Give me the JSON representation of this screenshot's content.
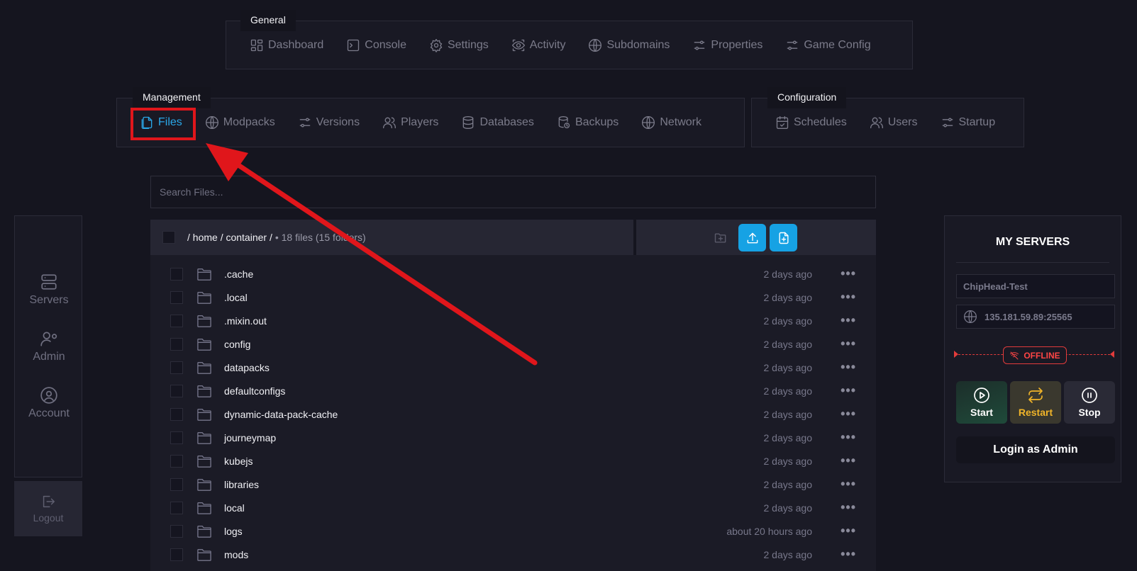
{
  "groups": {
    "general": {
      "title": "General",
      "items": [
        {
          "label": "Dashboard",
          "icon": "dashboard-icon"
        },
        {
          "label": "Console",
          "icon": "console-icon"
        },
        {
          "label": "Settings",
          "icon": "gear-icon"
        },
        {
          "label": "Activity",
          "icon": "eye-icon"
        },
        {
          "label": "Subdomains",
          "icon": "globe-icon"
        },
        {
          "label": "Properties",
          "icon": "sliders-icon"
        },
        {
          "label": "Game Config",
          "icon": "sliders-icon"
        }
      ]
    },
    "management": {
      "title": "Management",
      "items": [
        {
          "label": "Files",
          "icon": "files-icon",
          "active": true
        },
        {
          "label": "Modpacks",
          "icon": "globe-icon"
        },
        {
          "label": "Versions",
          "icon": "sliders-icon"
        },
        {
          "label": "Players",
          "icon": "users-icon"
        },
        {
          "label": "Databases",
          "icon": "database-icon"
        },
        {
          "label": "Backups",
          "icon": "backup-icon"
        },
        {
          "label": "Network",
          "icon": "globe-icon"
        }
      ]
    },
    "configuration": {
      "title": "Configuration",
      "items": [
        {
          "label": "Schedules",
          "icon": "calendar-icon"
        },
        {
          "label": "Users",
          "icon": "users-icon"
        },
        {
          "label": "Startup",
          "icon": "sliders-icon"
        }
      ]
    }
  },
  "search": {
    "placeholder": "Search Files..."
  },
  "path": {
    "text": "/ home / container /",
    "count": "• 18 files (15 folders)"
  },
  "files": [
    {
      "name": ".cache",
      "date": "2 days ago"
    },
    {
      "name": ".local",
      "date": "2 days ago"
    },
    {
      "name": ".mixin.out",
      "date": "2 days ago"
    },
    {
      "name": "config",
      "date": "2 days ago"
    },
    {
      "name": "datapacks",
      "date": "2 days ago"
    },
    {
      "name": "defaultconfigs",
      "date": "2 days ago"
    },
    {
      "name": "dynamic-data-pack-cache",
      "date": "2 days ago"
    },
    {
      "name": "journeymap",
      "date": "2 days ago"
    },
    {
      "name": "kubejs",
      "date": "2 days ago"
    },
    {
      "name": "libraries",
      "date": "2 days ago"
    },
    {
      "name": "local",
      "date": "2 days ago"
    },
    {
      "name": "logs",
      "date": "about 20 hours ago"
    },
    {
      "name": "mods",
      "date": "2 days ago"
    }
  ],
  "sidebar": {
    "servers": "Servers",
    "admin": "Admin",
    "account": "Account",
    "logout": "Logout"
  },
  "servers_panel": {
    "title": "MY SERVERS",
    "server_name": "ChipHead-Test",
    "address": "135.181.59.89:25565",
    "status": "OFFLINE",
    "start": "Start",
    "restart": "Restart",
    "stop": "Stop",
    "login_admin": "Login as Admin"
  },
  "colors": {
    "accent": "#2aa7e8",
    "highlight": "#e0161b",
    "offline": "#ff4545",
    "restart": "#f0b429"
  }
}
